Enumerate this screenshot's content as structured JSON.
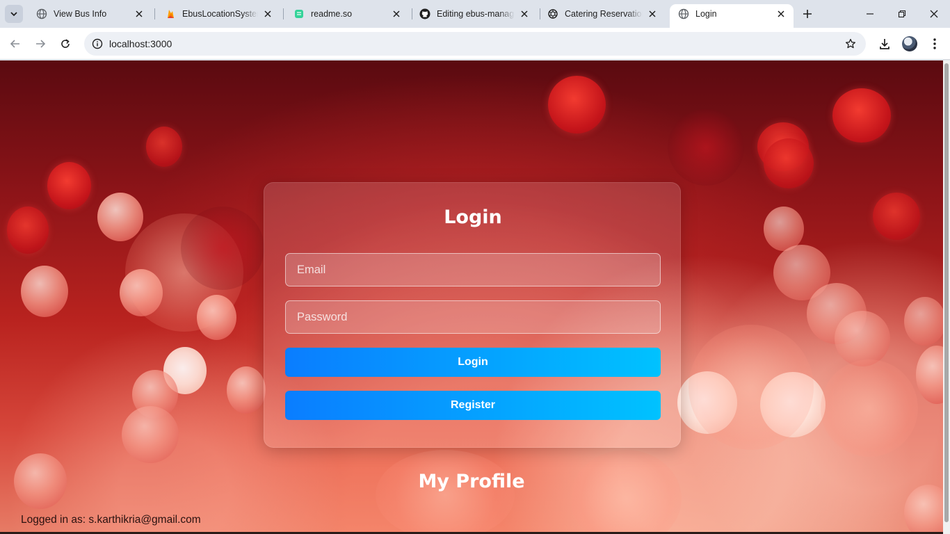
{
  "browser": {
    "tabs": [
      {
        "title": "View Bus Info",
        "favicon": "globe-icon"
      },
      {
        "title": "EbusLocationSystem - ",
        "favicon": "firebase-icon"
      },
      {
        "title": "readme.so",
        "favicon": "readme-icon"
      },
      {
        "title": "Editing ebus-manage",
        "favicon": "github-icon"
      },
      {
        "title": "Catering Reservation",
        "favicon": "openai-icon"
      },
      {
        "title": "Login",
        "favicon": "globe-icon",
        "active": true
      }
    ],
    "url": "localhost:3000"
  },
  "login": {
    "title": "Login",
    "email_placeholder": "Email",
    "password_placeholder": "Password",
    "login_button": "Login",
    "register_button": "Register"
  },
  "profile": {
    "heading": "My Profile",
    "logged_in_text": "Logged in as: s.karthikria@gmail.com"
  },
  "colors": {
    "button_gradient_start": "#0a7dff",
    "button_gradient_end": "#00c2ff",
    "background_main": "#b9231f"
  }
}
